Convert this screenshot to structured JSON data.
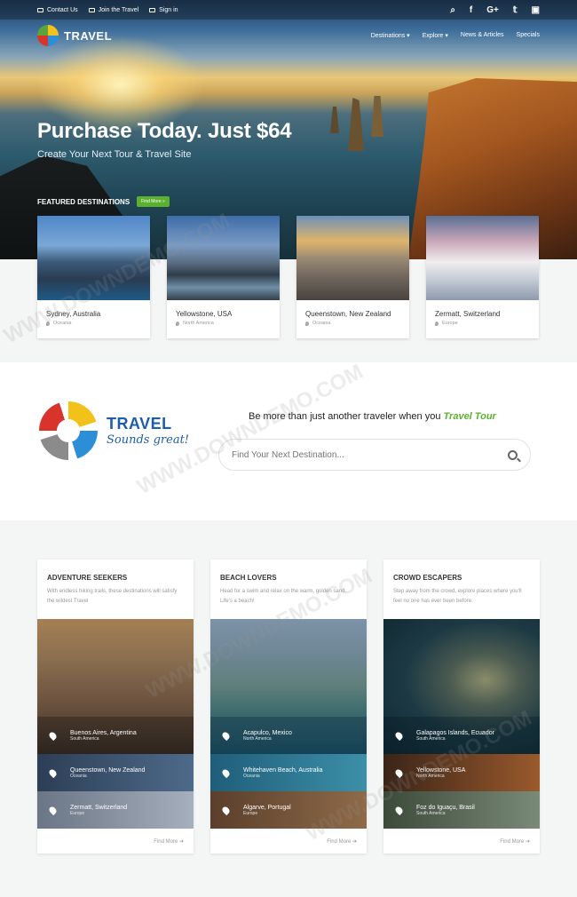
{
  "topbar": {
    "links": [
      {
        "label": "Contact Us",
        "icon": "envelope-icon"
      },
      {
        "label": "Join the Travel",
        "icon": "user-icon"
      },
      {
        "label": "Sign in",
        "icon": "signin-icon"
      }
    ],
    "social": [
      {
        "glyph": "⌕",
        "icon": "search-icon"
      },
      {
        "glyph": "f",
        "icon": "facebook-icon"
      },
      {
        "glyph": "G+",
        "icon": "google-plus-icon"
      },
      {
        "glyph": "𝕥",
        "icon": "twitter-icon"
      },
      {
        "glyph": "▣",
        "icon": "instagram-icon"
      }
    ]
  },
  "nav": {
    "logo": "TRAVEL",
    "menu": [
      "Destinations",
      "Explore",
      "News & Articles",
      "Specials"
    ]
  },
  "hero": {
    "title": "Purchase Today. Just $64",
    "subtitle": "Create Your Next Tour & Travel Site",
    "featured_label": "FEATURED DESTINATIONS",
    "find_more": "Find More"
  },
  "featured": [
    {
      "name": "Sydney, Australia",
      "region": "Oceania"
    },
    {
      "name": "Yellowstone, USA",
      "region": "North America"
    },
    {
      "name": "Queenstown, New Zealand",
      "region": "Oceania"
    },
    {
      "name": "Zermatt, Switzerland",
      "region": "Europe"
    }
  ],
  "brand": {
    "title": "TRAVEL",
    "slogan": "Sounds great!",
    "tagline": "Be more than just another traveler when you",
    "tagline_em": "Travel Tour",
    "search_placeholder": "Find Your Next Destination..."
  },
  "columns": [
    {
      "title": "ADVENTURE SEEKERS",
      "desc": "With endless hiking trails, these destinations will satisfy the wildest Travel",
      "rows": [
        {
          "name": "Buenos Aires, Argentina",
          "region": "South America"
        },
        {
          "name": "Queenstown, New Zealand",
          "region": "Oceania"
        },
        {
          "name": "Zermatt, Switzerland",
          "region": "Europe"
        }
      ],
      "more": "Find More"
    },
    {
      "title": "BEACH LOVERS",
      "desc": "Head for a swim and relax on the warm, golden sand. Life's a beach!",
      "rows": [
        {
          "name": "Acapulco, Mexico",
          "region": "North America"
        },
        {
          "name": "Whitehaven Beach, Australia",
          "region": "Oceania"
        },
        {
          "name": "Algarve, Portugal",
          "region": "Europe"
        }
      ],
      "more": "Find More"
    },
    {
      "title": "CROWD ESCAPERS",
      "desc": "Step away from the crowd, explore places where you'll feel no one has ever been before.",
      "rows": [
        {
          "name": "Galapagos Islands, Ecuador",
          "region": "South America"
        },
        {
          "name": "Yellowstone, USA",
          "region": "North America"
        },
        {
          "name": "Foz do Iguaçu, Brasil",
          "region": "South America"
        }
      ],
      "more": "Find More"
    }
  ],
  "watermark": "WWW.DOWNDEMO.COM"
}
